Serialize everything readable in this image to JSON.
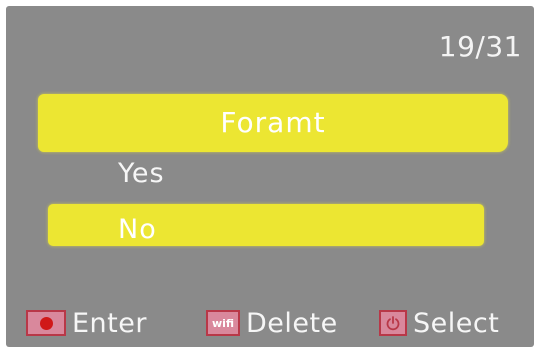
{
  "counter": "19/31",
  "dialog": {
    "title": "Foramt",
    "options": [
      {
        "label": "Yes",
        "selected": false
      },
      {
        "label": "No",
        "selected": true
      }
    ]
  },
  "footer": {
    "hints": [
      {
        "icon": "record-button-icon",
        "label": "Enter"
      },
      {
        "icon": "wifi-button-icon",
        "icon_text": "wifi",
        "label": "Delete"
      },
      {
        "icon": "power-button-icon",
        "label": "Select"
      }
    ]
  },
  "colors": {
    "screen_background": "#8a8a8a",
    "highlight": "#ece632",
    "text": "#ffffff",
    "icon_fill": "#d9889c",
    "icon_border": "#b83848",
    "record_dot": "#d01818"
  }
}
